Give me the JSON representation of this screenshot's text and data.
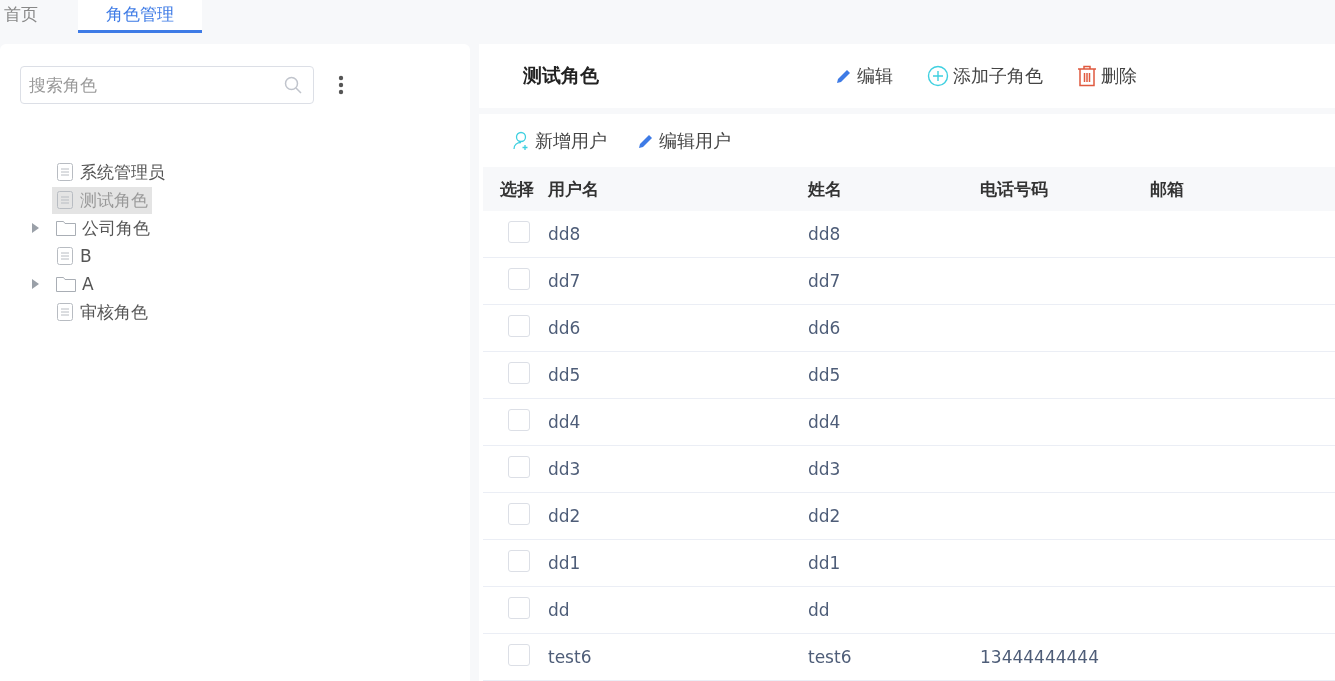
{
  "tabs": [
    {
      "label": "首页",
      "selected": false
    },
    {
      "label": "角色管理",
      "selected": true
    }
  ],
  "search": {
    "placeholder": "搜索角色"
  },
  "tree": [
    {
      "label": "系统管理员",
      "kind": "file",
      "selected": false
    },
    {
      "label": "测试角色",
      "kind": "file",
      "selected": true
    },
    {
      "label": "公司角色",
      "kind": "folder",
      "selected": false,
      "expanded": false
    },
    {
      "label": "B",
      "kind": "file",
      "selected": false
    },
    {
      "label": "A",
      "kind": "folder",
      "selected": false,
      "expanded": false
    },
    {
      "label": "审核角色",
      "kind": "file",
      "selected": false
    }
  ],
  "role_title": "测试角色",
  "role_actions": [
    {
      "label": "编辑",
      "kind": "edit"
    },
    {
      "label": "添加子角色",
      "kind": "add"
    },
    {
      "label": "删除",
      "kind": "delete"
    }
  ],
  "user_actions": [
    {
      "label": "新增用户",
      "kind": "user"
    },
    {
      "label": "编辑用户",
      "kind": "edit"
    }
  ],
  "table": {
    "columns": [
      "选择",
      "用户名",
      "姓名",
      "电话号码",
      "邮箱"
    ],
    "rows": [
      {
        "checked": false,
        "username": "dd8",
        "name": "dd8",
        "phone": ""
      },
      {
        "checked": false,
        "username": "dd7",
        "name": "dd7",
        "phone": ""
      },
      {
        "checked": false,
        "username": "dd6",
        "name": "dd6",
        "phone": ""
      },
      {
        "checked": false,
        "username": "dd5",
        "name": "dd5",
        "phone": ""
      },
      {
        "checked": false,
        "username": "dd4",
        "name": "dd4",
        "phone": ""
      },
      {
        "checked": false,
        "username": "dd3",
        "name": "dd3",
        "phone": ""
      },
      {
        "checked": false,
        "username": "dd2",
        "name": "dd2",
        "phone": ""
      },
      {
        "checked": false,
        "username": "dd1",
        "name": "dd1",
        "phone": ""
      },
      {
        "checked": false,
        "username": "dd",
        "name": "dd",
        "phone": ""
      },
      {
        "checked": false,
        "username": "test6",
        "name": "test6",
        "phone": "13444444444"
      }
    ]
  }
}
